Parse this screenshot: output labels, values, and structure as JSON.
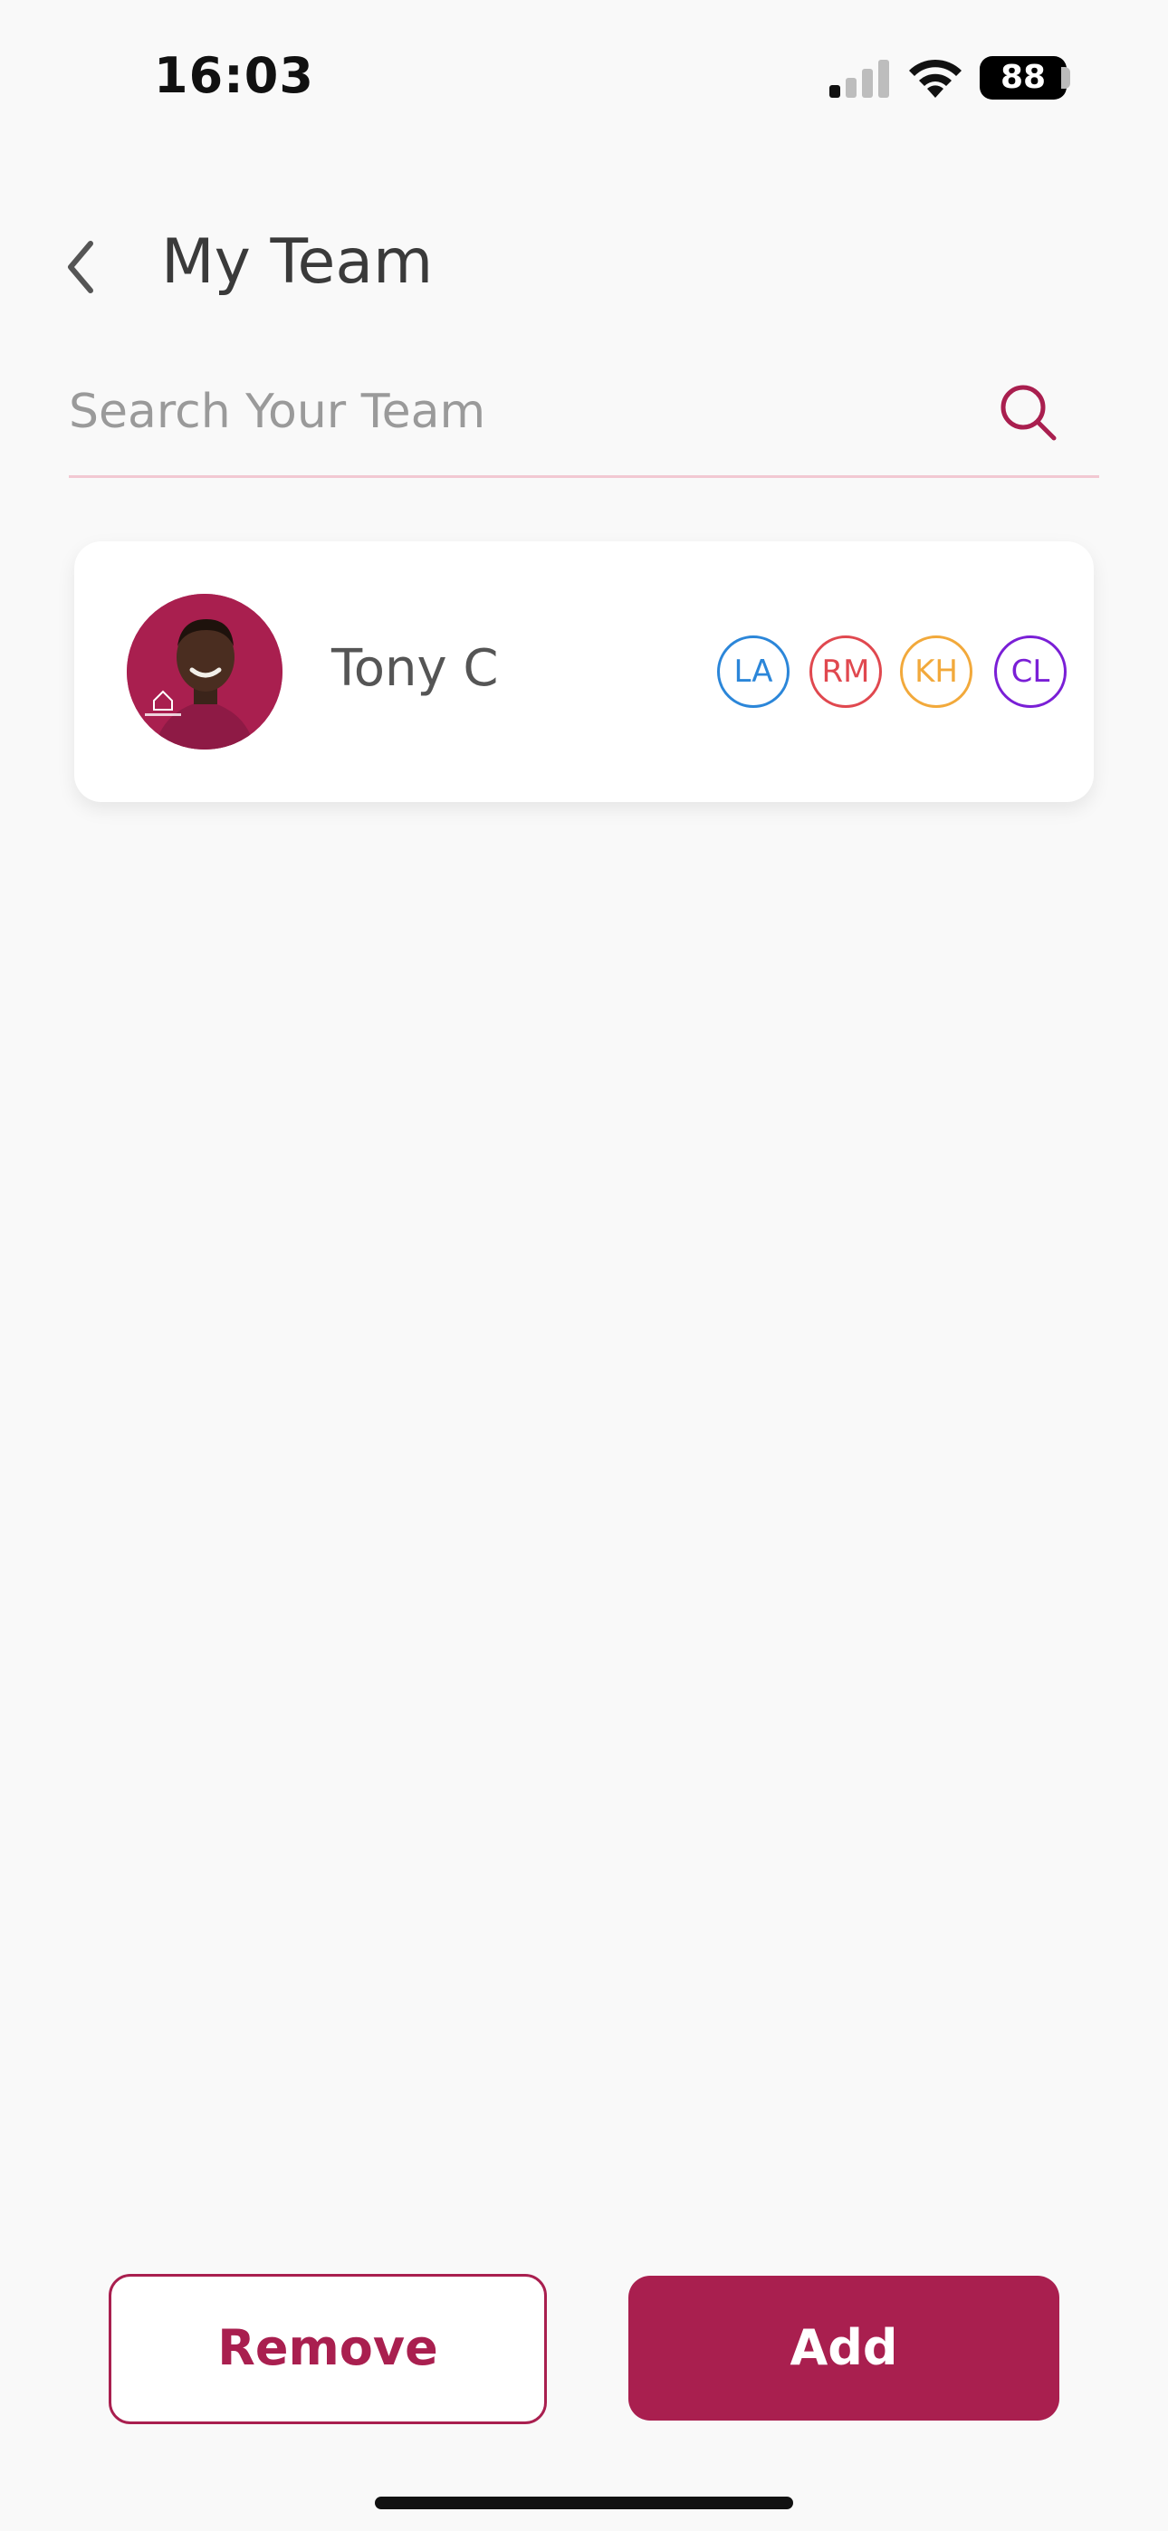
{
  "status_bar": {
    "time": "16:03",
    "battery": "88",
    "signal_icon": "cellular-signal-icon",
    "wifi_icon": "wifi-icon"
  },
  "header": {
    "title": "My Team",
    "back_icon": "chevron-left-icon"
  },
  "search": {
    "placeholder": "Search Your Team",
    "value": "",
    "icon": "search-icon"
  },
  "team": {
    "members": [
      {
        "name": "Tony C",
        "avatar": "profile-photo",
        "badges": [
          {
            "initials": "LA",
            "color": "#2b86d9"
          },
          {
            "initials": "RM",
            "color": "#e0484f"
          },
          {
            "initials": "KH",
            "color": "#f2a93b"
          },
          {
            "initials": "CL",
            "color": "#7a1fd6"
          }
        ]
      }
    ]
  },
  "actions": {
    "remove_label": "Remove",
    "add_label": "Add"
  },
  "colors": {
    "accent": "#a91f4f",
    "background": "#f9f9f9",
    "search_underline": "#f2c8d2"
  }
}
